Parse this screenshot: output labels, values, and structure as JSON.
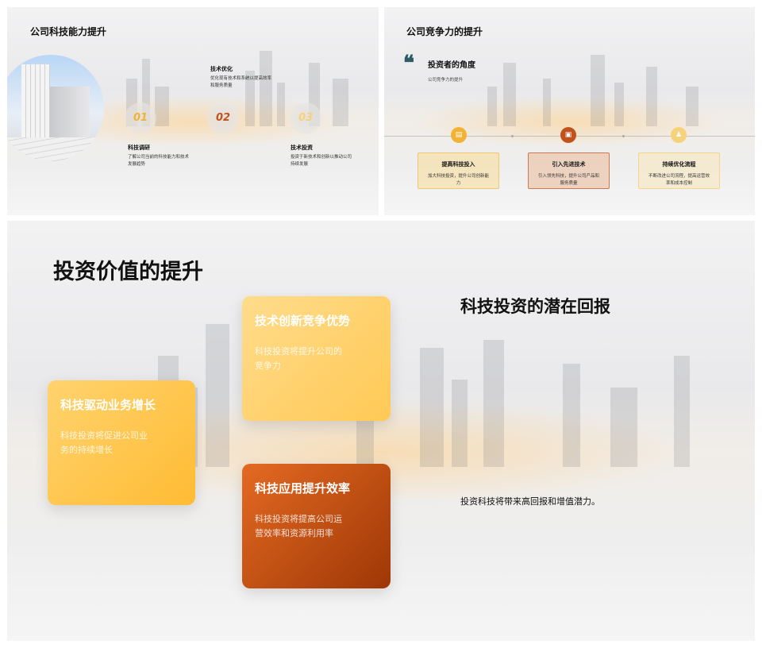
{
  "slide1": {
    "title": "公司科技能力提升",
    "steps": [
      {
        "num": "01",
        "title": "科技调研",
        "desc": "了解公司当前的科技能力和技术发展趋势",
        "color": "#f2b233"
      },
      {
        "num": "02",
        "title": "技术优化",
        "desc": "优化现有技术和系统以提高效率和服务质量",
        "color": "#c2521c"
      },
      {
        "num": "03",
        "title": "技术投资",
        "desc": "投资于新技术和创新以推动公司持续发展",
        "color": "#f6d27a"
      }
    ]
  },
  "slide2": {
    "title": "公司竞争力的提升",
    "quote_mark": "❝",
    "perspective_title": "投资者的角度",
    "perspective_sub": "公司竞争力的提升",
    "cards": [
      {
        "icon": "document-icon",
        "glyph": "▤",
        "title": "提高科技投入",
        "desc": "加大科技投资，提升公司创新能力",
        "accent": "#f2b233"
      },
      {
        "icon": "image-icon",
        "glyph": "▣",
        "title": "引入先进技术",
        "desc": "引入领先科技，提升公司产品和服务质量",
        "accent": "#c2521c"
      },
      {
        "icon": "bell-icon",
        "glyph": "♟",
        "title": "持续优化流程",
        "desc": "不断改进公司流程，提高运营效率和成本控制",
        "accent": "#f6d27a"
      }
    ]
  },
  "slide3": {
    "title": "投资价值的提升",
    "cards": [
      {
        "title": "科技驱动业务增长",
        "desc": "科技投资将促进公司业务的持续增长"
      },
      {
        "title": "技术创新竞争优势",
        "desc": "科技投资将提升公司的竞争力"
      },
      {
        "title": "科技应用提升效率",
        "desc": "科技投资将提高公司运营效率和资源利用率"
      }
    ],
    "right_title": "科技投资的潜在回报",
    "right_desc": "投资科技将带来高回报和增值潜力。"
  },
  "colors": {
    "accent_yellow": "#f2b233",
    "accent_orange": "#c2521c",
    "accent_light": "#f6d27a",
    "quote": "#2d5a64"
  }
}
